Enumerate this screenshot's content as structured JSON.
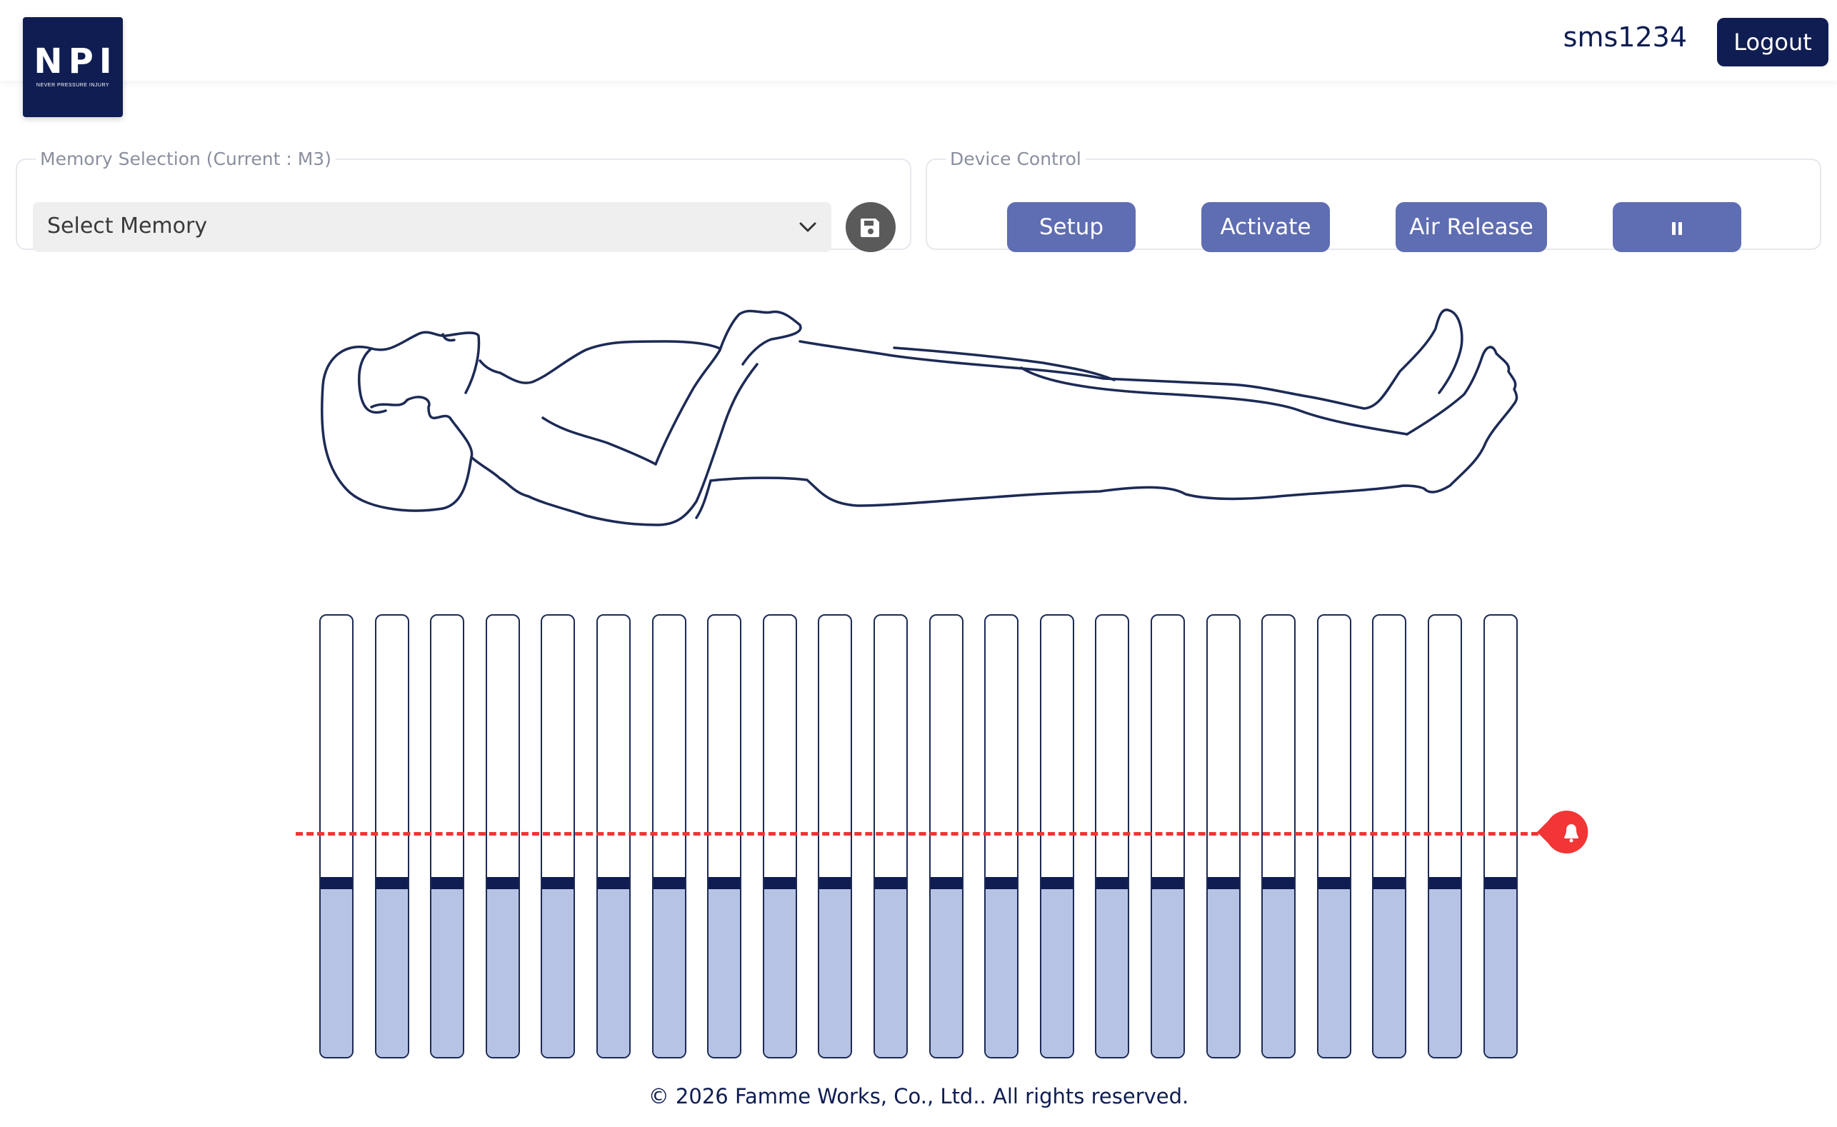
{
  "header": {
    "logo": {
      "text": "NPI",
      "subtext": "NEVER PRESSURE INJURY"
    },
    "username": "sms1234",
    "logout_label": "Logout"
  },
  "memory_panel": {
    "legend": "Memory Selection (Current : M3)",
    "select_value": "Select Memory",
    "save_icon": "floppy-disk-icon"
  },
  "device_panel": {
    "legend": "Device Control",
    "buttons": [
      {
        "label": "Setup"
      },
      {
        "label": "Activate"
      },
      {
        "label": "Air Release"
      },
      {
        "label": "",
        "icon": "pause-icon"
      }
    ]
  },
  "pressure": {
    "cells": [
      0.39,
      0.39,
      0.39,
      0.39,
      0.39,
      0.39,
      0.39,
      0.39,
      0.39,
      0.39,
      0.39,
      0.39,
      0.39,
      0.39,
      0.39,
      0.39,
      0.39,
      0.39,
      0.39,
      0.39,
      0.39,
      0.39
    ],
    "alarm_threshold": 0.51,
    "alarm_icon": "bell-icon"
  },
  "colors": {
    "primary": "#0f1d52",
    "button": "#5f6db2",
    "fill": "#b6c3e4",
    "alarm": "#f23535"
  },
  "footer": "© 2026 Famme Works, Co., Ltd.. All rights reserved."
}
